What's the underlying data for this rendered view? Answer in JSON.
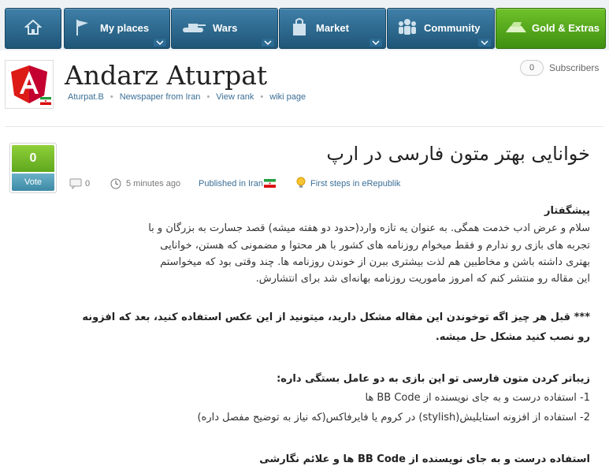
{
  "nav": {
    "tabs": [
      {
        "label": ""
      },
      {
        "label": "My places"
      },
      {
        "label": "Wars"
      },
      {
        "label": "Market"
      },
      {
        "label": "Community"
      },
      {
        "label": "Gold & Extras"
      }
    ]
  },
  "header": {
    "title": "Andarz Aturpat",
    "owner": "Aturpat.B",
    "newspaper": "Newspaper from Iran",
    "view_rank": "View rank",
    "wiki": "wiki page",
    "subscribers_count": "0",
    "subscribers_label": "Subscribers"
  },
  "vote": {
    "count": "0",
    "label": "Vote"
  },
  "article": {
    "title": "خوانایی بهتر متون فارسی در ارپ",
    "comments": "0",
    "time": "5 minutes ago",
    "published": "Published in Iran",
    "category": "First steps in eRepublik",
    "heading1": "پیشگفتار",
    "p1": [
      "سلام و عرض ادب خدمت همگی. به عنوان یه تازه وارد(حدود دو هفته میشه) قصد جسارت به بزرگان و با",
      "تجربه های بازی رو ندارم و فقط میخوام روزنامه های کشور با هر محتوا و مضمونی که هستن، خوانایی",
      "بهتری داشته باشن و مخاطبین هم لذت بیشتری ببرن از خوندن روزنامه ها. چند وقتی بود که میخواستم",
      "این مقاله رو منتشر کنم که امروز ماموریت روزنامه بهانه‌ای شد برای انتشارش."
    ],
    "p2": [
      "*** قبل هر چیز اگه توخوندن این مقاله مشکل دارید، میتونید از این عکس استفاده کنید، بعد که افزونه",
      "رو نصب کنید مشکل حل میشه."
    ],
    "heading2": "زیباتر کردن متون فارسی تو این بازی به دو عامل بستگی داره:",
    "list": [
      "1- استفاده درست و به جای نویسنده از BB Code ها",
      "2- استفاده از افزونه استایلیش(stylish) در کروم یا فایرفاکس(که نیاز به توضیح مفصل داره)"
    ],
    "heading3": "استفاده درست و به جای نویسنده از BB Code ها و علائم نگارشی"
  },
  "colors": {
    "nav_blue": "#2a6a92",
    "gold_green": "#58a81c",
    "link": "#3b6f97",
    "vote_green": "#7cc12d",
    "vote_blue": "#4a97b3"
  }
}
